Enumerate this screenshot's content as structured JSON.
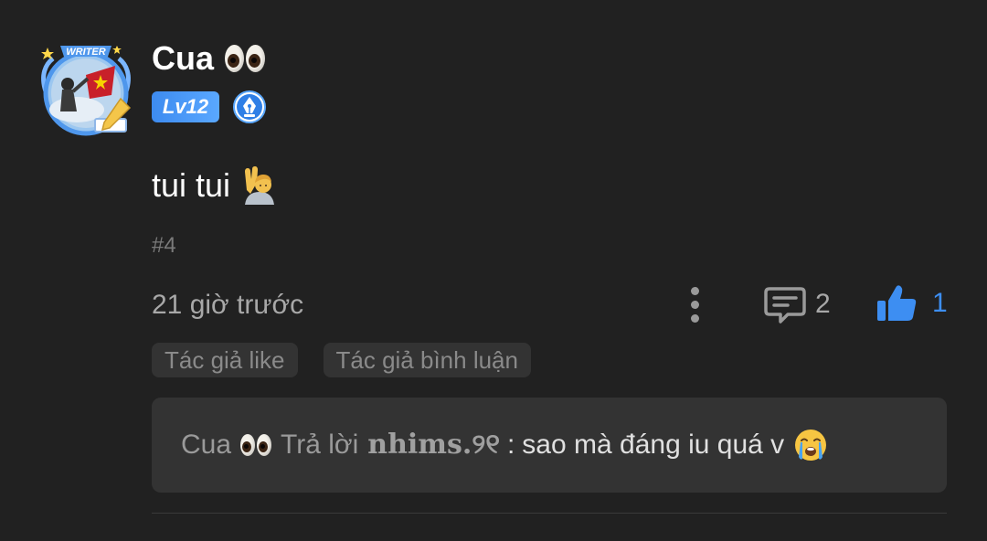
{
  "comment": {
    "avatar": {
      "frame_label": "WRITER",
      "icon": "avatar-writer-frame"
    },
    "username": "Cua",
    "username_emoji": "eyes-emoji",
    "level_badge": "Lv12",
    "writer_badge_icon": "pen-nib-icon",
    "content_text": "tui tui",
    "content_emoji": "person-raising-hand-emoji",
    "floor": "#4",
    "time": "21 giờ trước",
    "actions": {
      "more_icon": "more-vertical-icon",
      "reply_icon": "comment-icon",
      "reply_count": "2",
      "like_icon": "thumbs-up-icon",
      "like_count": "1"
    },
    "tags": [
      "Tác giả like",
      "Tác giả bình luận"
    ],
    "reply_preview": {
      "author": "Cua",
      "reply_word": "Trả lời",
      "target_user": "nhims.୨୧",
      "separator": ":",
      "text": "sao mà đáng iu quá v",
      "emoji": "loudly-crying-face-emoji"
    }
  },
  "colors": {
    "background": "#212121",
    "accent_blue": "#3d8ef2",
    "tag_bg": "#333333",
    "muted_text": "#a8a8a8"
  }
}
